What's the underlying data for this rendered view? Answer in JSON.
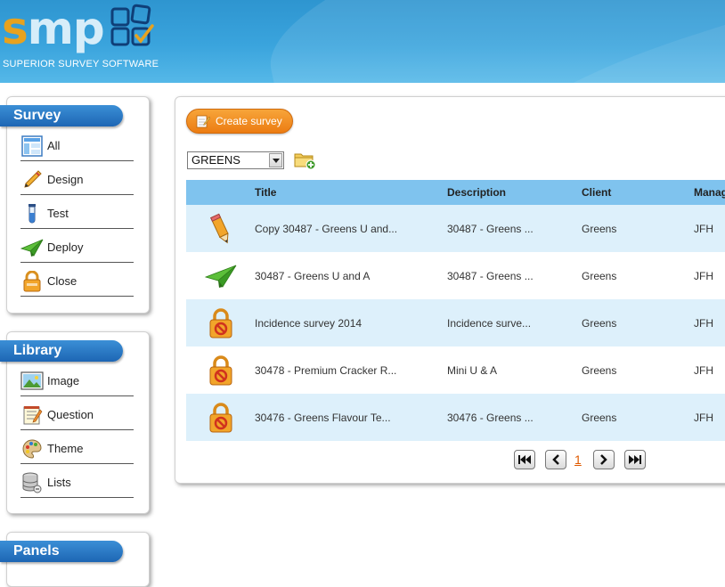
{
  "header": {
    "logo_text_s": "s",
    "logo_text_mp": "mp",
    "tagline": "SUPERIOR SURVEY SOFTWARE"
  },
  "sidebar": {
    "survey": {
      "title": "Survey",
      "items": [
        {
          "label": "All",
          "icon": "layout-icon"
        },
        {
          "label": "Design",
          "icon": "pencil-icon"
        },
        {
          "label": "Test",
          "icon": "test-tube-icon"
        },
        {
          "label": "Deploy",
          "icon": "paper-plane-icon"
        },
        {
          "label": "Close",
          "icon": "lock-icon"
        }
      ]
    },
    "library": {
      "title": "Library",
      "items": [
        {
          "label": "Image",
          "icon": "image-icon"
        },
        {
          "label": "Question",
          "icon": "notepad-icon"
        },
        {
          "label": "Theme",
          "icon": "palette-icon"
        },
        {
          "label": "Lists",
          "icon": "database-icon"
        }
      ]
    },
    "panels": {
      "title": "Panels"
    }
  },
  "main": {
    "create_button": "Create survey",
    "client_select": "GREENS",
    "table": {
      "headers": [
        "Title",
        "Description",
        "Client",
        "Manag"
      ],
      "rows": [
        {
          "status_icon": "pencil-icon",
          "title": "Copy 30487 - Greens U and...",
          "description": "30487 - Greens ...",
          "client": "Greens",
          "manager": "JFH"
        },
        {
          "status_icon": "paper-plane-icon",
          "title": "30487 - Greens U and A",
          "description": "30487 - Greens ...",
          "client": "Greens",
          "manager": "JFH"
        },
        {
          "status_icon": "lock-icon",
          "title": "Incidence survey 2014",
          "description": "Incidence surve...",
          "client": "Greens",
          "manager": "JFH"
        },
        {
          "status_icon": "lock-icon",
          "title": "30478 - Premium Cracker R...",
          "description": "Mini U & A",
          "client": "Greens",
          "manager": "JFH"
        },
        {
          "status_icon": "lock-icon",
          "title": "30476 - Greens Flavour Te...",
          "description": "30476 - Greens ...",
          "client": "Greens",
          "manager": "JFH"
        }
      ]
    },
    "pager": {
      "current_page": "1"
    }
  },
  "colors": {
    "header_blue": "#3aa4dd",
    "accent_orange": "#ec7c12",
    "table_header": "#7fc3ee",
    "row_alt": "#ddf0fb",
    "panel_title_blue": "#1d66b4"
  }
}
